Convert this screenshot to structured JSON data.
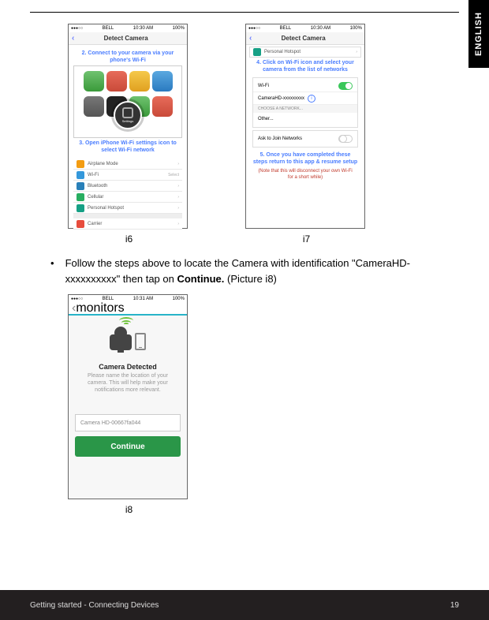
{
  "langTab": "ENGLISH",
  "statusBar": {
    "carrier": "BELL",
    "time": "10:30 AM",
    "battery": "100%",
    "time8": "10:31 AM"
  },
  "i6": {
    "navTitle": "Detect Camera",
    "step2": "2. Connect to your camera via your phone's Wi-Fi",
    "gearLabel": "Settings",
    "step3": "3. Open iPhone Wi-Fi settings icon to select Wi-Fi network",
    "rows": {
      "airplane": "Airplane Mode",
      "wifi": "Wi-Fi",
      "wifiR": "Select",
      "bt": "Bluetooth",
      "cell": "Cellular",
      "hotspot": "Personal Hotspot",
      "carrier": "Carrier"
    },
    "caption": "i6"
  },
  "i7": {
    "navTitle": "Detect Camera",
    "topRow": "Personal Hotspot",
    "step4": "4. Click on Wi-Fi icon and select your camera from the list of networks",
    "wifiLabel": "Wi-Fi",
    "netName": "CameraHD-xxxxxxxxx",
    "chooseLbl": "CHOOSE A NETWORK...",
    "other": "Other...",
    "askJoin": "Ask to Join Networks",
    "step5": "5. Once you have completed these steps return to this app & resume setup",
    "note": "(Note that this will disconnect your own Wi-Fi for a short while)",
    "caption": "i7"
  },
  "bodyText": {
    "pre": "Follow the steps above to locate the Camera with identification \"CameraHD-xxxxxxxxxx\" then tap on ",
    "bold": "Continue.",
    "post": " (Picture i8)"
  },
  "i8": {
    "navBack": "monitors",
    "heading": "Camera Detected",
    "sub": "Please name the location of your camera. This will help make your notifications more relevant.",
    "inputVal": "Camera HD-00667fa044",
    "button": "Continue",
    "caption": "i8"
  },
  "footer": {
    "left": "Getting started - Connecting Devices",
    "right": "19"
  }
}
